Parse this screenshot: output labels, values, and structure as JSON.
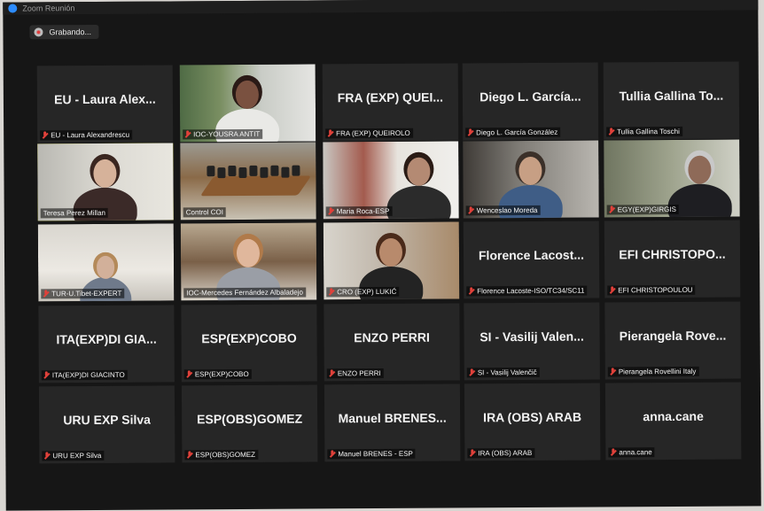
{
  "window": {
    "title": "Zoom Reunión"
  },
  "recording": {
    "label": "Grabando..."
  },
  "tiles": [
    {
      "id": "t0",
      "display_name": "EU - Laura Alex...",
      "label": "EU - Laura Alexandrescu",
      "muted": true
    },
    {
      "id": "t1",
      "video": true,
      "label": "IOC-YOUSRA ANTIT",
      "muted": true
    },
    {
      "id": "t2",
      "display_name": "FRA (EXP) QUEI...",
      "label": "FRA (EXP) QUEIROLO",
      "muted": true
    },
    {
      "id": "t3",
      "display_name": "Diego L. García...",
      "label": "Diego L. García González",
      "muted": true
    },
    {
      "id": "t4",
      "display_name": "Tullia Gallina To...",
      "label": "Tullia Gallina Toschi",
      "muted": true
    },
    {
      "id": "t5",
      "video": true,
      "label": "Teresa Perez Millan",
      "muted": false,
      "active_speaker": true
    },
    {
      "id": "t6",
      "video": true,
      "label": "Control COI",
      "muted": false
    },
    {
      "id": "t7",
      "video": true,
      "label": "Maria Roca-ESP",
      "muted": true
    },
    {
      "id": "t8",
      "video": true,
      "label": "Wenceslao Moreda",
      "muted": true
    },
    {
      "id": "t9",
      "video": true,
      "label": "EGY(EXP)GIRGIS",
      "muted": true
    },
    {
      "id": "t10",
      "video": true,
      "label": "TUR-U.Tibet-EXPERT",
      "muted": true
    },
    {
      "id": "t11",
      "video": true,
      "label": "IOC-Mercedes Fernández Albaladejo",
      "muted": false
    },
    {
      "id": "t12",
      "video": true,
      "label": "CRO (EXP) LUKIĆ",
      "muted": true
    },
    {
      "id": "t13",
      "display_name": "Florence Lacost...",
      "label": "Florence Lacoste-ISO/TC34/SC11",
      "muted": true
    },
    {
      "id": "t14",
      "display_name": "EFI CHRISTOPO...",
      "label": "EFI CHRISTOPOULOU",
      "muted": true
    },
    {
      "id": "t15",
      "display_name": "ITA(EXP)DI GIA...",
      "label": "ITA(EXP)DI GIACINTO",
      "muted": true
    },
    {
      "id": "t16",
      "display_name": "ESP(EXP)COBO",
      "label": "ESP(EXP)COBO",
      "muted": true
    },
    {
      "id": "t17",
      "display_name": "ENZO PERRI",
      "label": "ENZO PERRI",
      "muted": true
    },
    {
      "id": "t18",
      "display_name": "SI - Vasilij Valen...",
      "label": "SI - Vasilij Valenčič",
      "muted": true
    },
    {
      "id": "t19",
      "display_name": "Pierangela Rove...",
      "label": "Pierangela Rovellini Italy",
      "muted": true
    },
    {
      "id": "t20",
      "display_name": "URU EXP Silva",
      "label": "URU EXP Silva",
      "muted": true
    },
    {
      "id": "t21",
      "display_name": "ESP(OBS)GOMEZ",
      "label": "ESP(OBS)GOMEZ",
      "muted": true
    },
    {
      "id": "t22",
      "display_name": "Manuel BRENES...",
      "label": "Manuel BRENES - ESP",
      "muted": true
    },
    {
      "id": "t23",
      "display_name": "IRA (OBS) ARAB",
      "label": "IRA (OBS) ARAB",
      "muted": true
    },
    {
      "id": "t24",
      "display_name": "anna.cane",
      "label": "anna.cane",
      "muted": true
    }
  ],
  "icons": {
    "recording": "record-icon",
    "muted": "mic-muted-icon"
  },
  "colors": {
    "background": "#161616",
    "tile": "#262626",
    "muted_icon": "#e0413a",
    "active_speaker": "#d6d83a"
  }
}
